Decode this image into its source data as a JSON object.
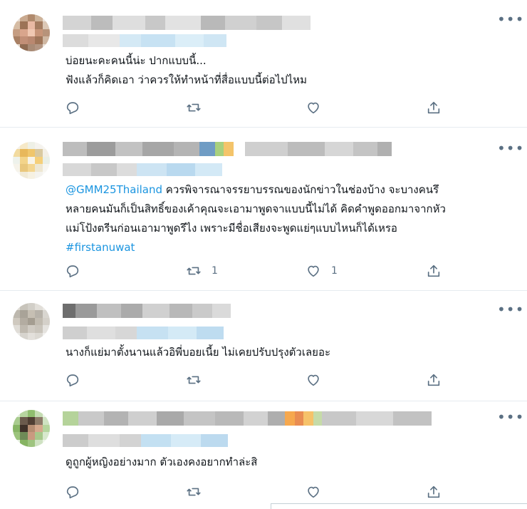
{
  "tweets": [
    {
      "lines": [
        "บ่อยนะคะคนนี้น่ะ ปากแบบนี้...",
        "ฟังแล้วก็คิดเอา ว่าควรให้ทำหน้าที่สื่อแบบนี้ต่อไปไหม"
      ],
      "retweets": "",
      "likes": ""
    },
    {
      "mention": "@GMM25Thailand",
      "line1_rest": " ควรพิจารณาจรรยาบรรณของนักข่าวในช่องบ้าง จะบางคนรึ",
      "line2": "หลายคนมันก็เป็นสิทธิ์ของเค้าคุณจะเอามาพูดจาแบบนี้ไม่ได้ คิดคำพูดออกมาจากหัว",
      "line3": "แม่โป้งตรีนก่อนเอามาพูดรึไง เพราะมีชื่อเสียงจะพูดแย่ๆแบบไหนก็ได้เหรอ",
      "hashtag": "#firstanuwat",
      "retweets": "1",
      "likes": "1"
    },
    {
      "lines": [
        "นางก็แย่มาตั้งนานแล้วอิพี่บอยเนี้ย ไม่เคยปรับปรุงตัวเลยอะ"
      ],
      "retweets": "",
      "likes": ""
    },
    {
      "lines": [
        "ดูถูกผู้หญิงอย่างมาก ตัวเองคงอยากทำล่ะสิ"
      ],
      "retweets": "",
      "likes": ""
    }
  ],
  "icons": {
    "more": "more-icon",
    "reply": "reply-icon",
    "retweet": "retweet-icon",
    "like": "like-icon",
    "share": "share-icon"
  },
  "colors": {
    "link": "#1b95e0",
    "icon": "#5b7083",
    "separator": "#e6ecf0"
  }
}
